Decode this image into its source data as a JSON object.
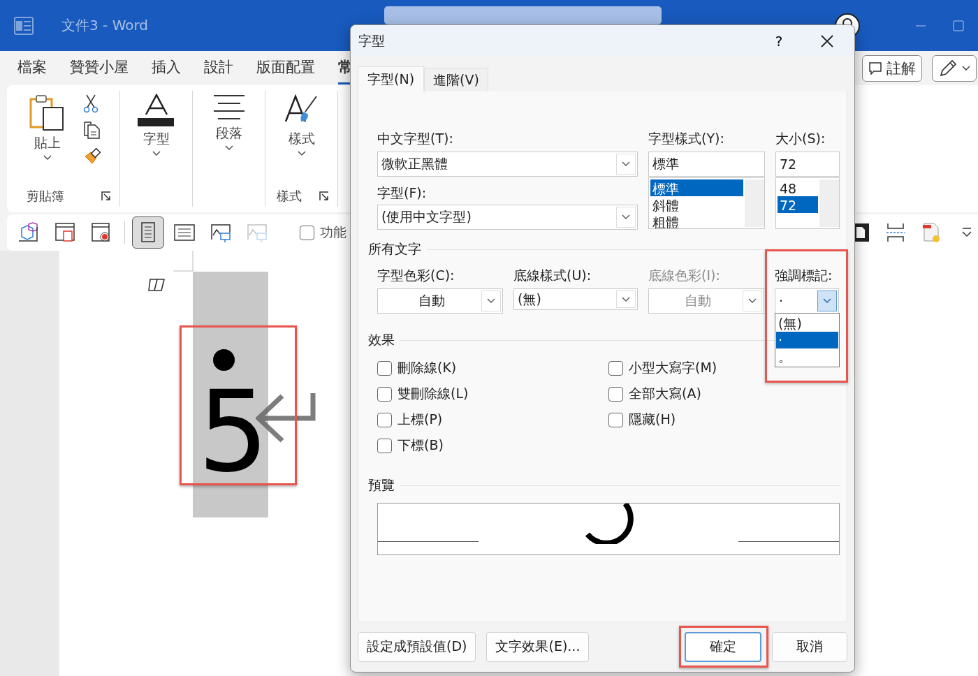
{
  "app": {
    "title": "文件3 - Word"
  },
  "menu_tabs": [
    {
      "label": "檔案",
      "selected": false
    },
    {
      "label": "贊贊小屋",
      "selected": false
    },
    {
      "label": "插入",
      "selected": false
    },
    {
      "label": "設計",
      "selected": false
    },
    {
      "label": "版面配置",
      "selected": false
    },
    {
      "label": "常",
      "selected": true
    }
  ],
  "comment_button": {
    "label": "註解"
  },
  "ribbon": {
    "groups": [
      {
        "kind": "clipboard",
        "big_label": "貼上",
        "label": "剪貼簿"
      },
      {
        "kind": "font",
        "big_label": "字型"
      },
      {
        "kind": "paragraph",
        "big_label": "段落"
      },
      {
        "kind": "styles",
        "big_label": "樣式",
        "label": "樣式"
      }
    ]
  },
  "view_toolbar": {
    "left": [
      {
        "kind": "cube",
        "selected": false,
        "disabled": false
      },
      {
        "kind": "form",
        "selected": false,
        "disabled": false
      },
      {
        "kind": "record",
        "selected": false,
        "disabled": false
      },
      {
        "kind": "separator"
      },
      {
        "kind": "page",
        "selected": true,
        "disabled": false
      },
      {
        "kind": "list",
        "selected": false,
        "disabled": false
      },
      {
        "kind": "picture",
        "selected": false,
        "disabled": false
      },
      {
        "kind": "picture",
        "selected": false,
        "disabled": true
      }
    ],
    "checkbox": {
      "label": "功能",
      "checked": false
    },
    "right": [
      {
        "kind": "frame",
        "selected": false,
        "disabled": false
      },
      {
        "kind": "break",
        "selected": false,
        "disabled": false
      },
      {
        "kind": "file",
        "selected": false,
        "disabled": false
      },
      {
        "kind": "more",
        "selected": false,
        "disabled": false
      }
    ]
  },
  "document": {
    "text": "5",
    "emphasis_mark": true,
    "selected": true,
    "highlighted": true
  },
  "dialog": {
    "title": "字型",
    "help": "?",
    "tabs": [
      {
        "label": "字型(N)",
        "selected": true
      },
      {
        "label": "進階(V)",
        "selected": false
      }
    ],
    "chinese_font": {
      "label": "中文字型(T):",
      "value": "微軟正黑體"
    },
    "font": {
      "label": "字型(F):",
      "value": "(使用中文字型)"
    },
    "style": {
      "label": "字型樣式(Y):",
      "value": "標準",
      "options": [
        {
          "label": "標準",
          "selected": true
        },
        {
          "label": "斜體",
          "selected": false
        },
        {
          "label": "粗體",
          "selected": false
        }
      ]
    },
    "size": {
      "label": "大小(S):",
      "value": "72",
      "options": [
        {
          "label": "48",
          "selected": false
        },
        {
          "label": "72",
          "selected": true
        }
      ]
    },
    "all_text": {
      "heading": "所有文字",
      "combos": [
        {
          "label": "字型色彩(C):",
          "value": "自動",
          "kind": "color",
          "disabled": false,
          "expanded": false
        },
        {
          "label": "底線樣式(U):",
          "value": "(無)",
          "kind": "list",
          "disabled": false,
          "expanded": false
        },
        {
          "label": "底線色彩(I):",
          "value": "自動",
          "kind": "color",
          "disabled": true,
          "expanded": false
        },
        {
          "label": "強調標記:",
          "value": "·",
          "kind": "list",
          "disabled": false,
          "expanded": true,
          "highlighted": true,
          "options": [
            {
              "label": "(無)",
              "selected": false
            },
            {
              "label": "·",
              "selected": true
            },
            {
              "label": "。",
              "selected": false
            }
          ]
        }
      ]
    },
    "effects": {
      "heading": "效果",
      "left": [
        {
          "label": "刪除線(K)",
          "checked": false
        },
        {
          "label": "雙刪除線(L)",
          "checked": false
        },
        {
          "label": "上標(P)",
          "checked": false
        },
        {
          "label": "下標(B)",
          "checked": false
        }
      ],
      "right": [
        {
          "label": "小型大寫字(M)",
          "checked": false
        },
        {
          "label": "全部大寫(A)",
          "checked": false
        },
        {
          "label": "隱藏(H)",
          "checked": false
        }
      ]
    },
    "preview": {
      "heading": "預覽"
    },
    "buttons": [
      {
        "label": "設定成預設值(D)",
        "kind": "left"
      },
      {
        "label": "文字效果(E)...",
        "kind": "left"
      },
      {
        "label": "確定",
        "kind": "default",
        "highlighted": true
      },
      {
        "label": "取消",
        "kind": "right"
      }
    ]
  }
}
